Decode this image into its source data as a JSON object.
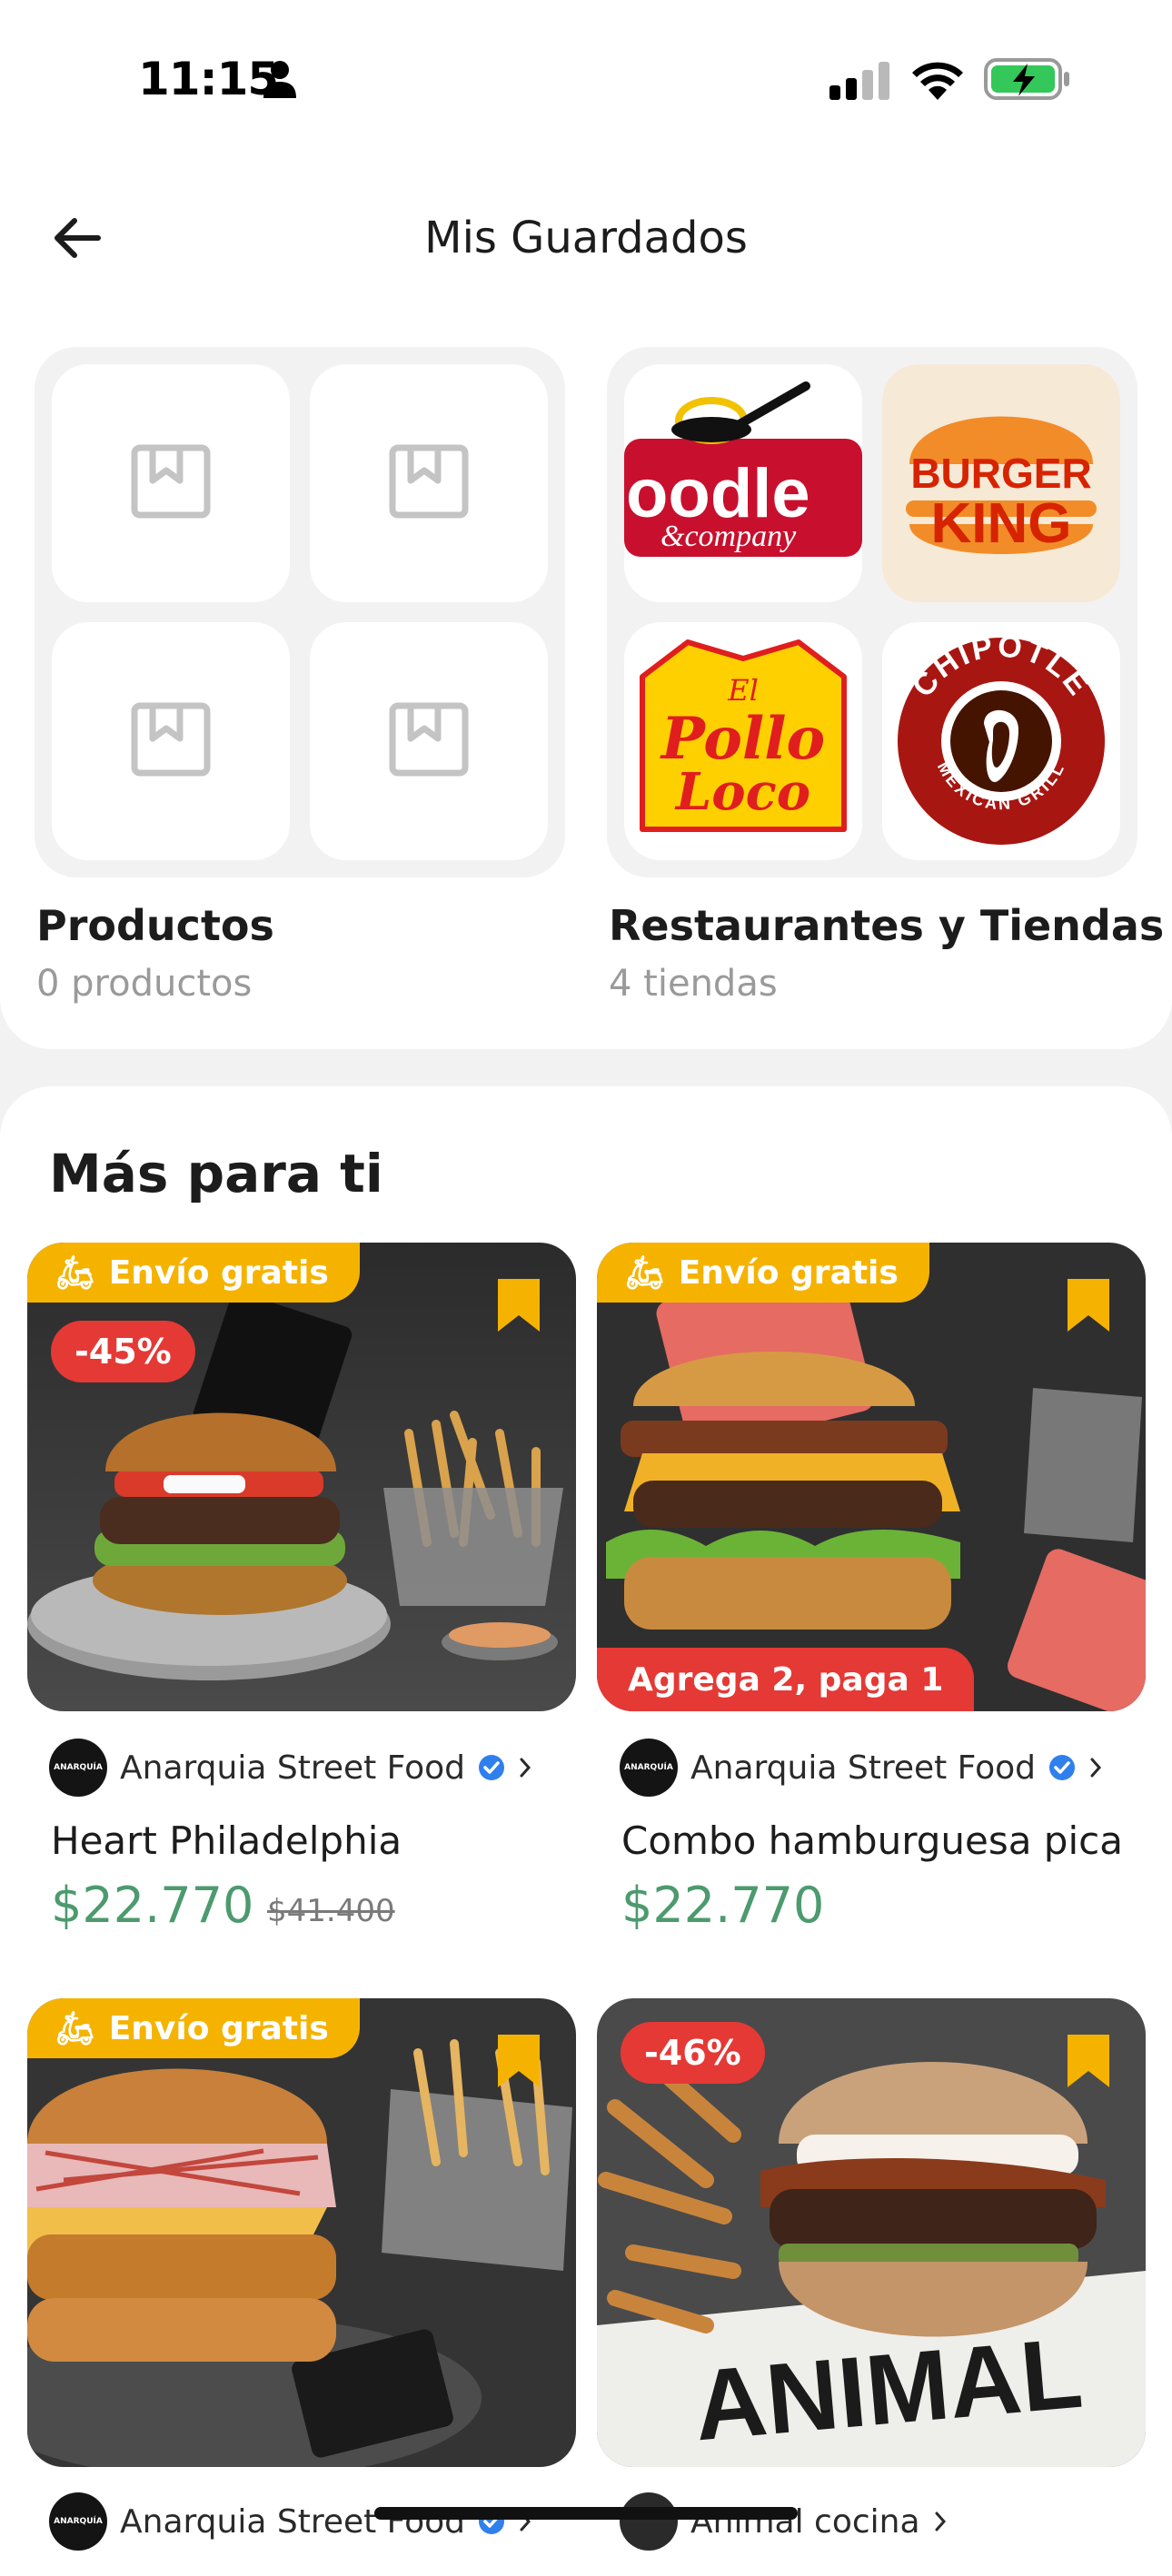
{
  "status_bar": {
    "time": "11:15"
  },
  "header": {
    "title": "Mis Guardados"
  },
  "groups": [
    {
      "title": "Productos",
      "subtitle": "0 productos"
    },
    {
      "title": "Restaurantes y Tiendas",
      "subtitle": "4 tiendas",
      "logos": [
        {
          "name": "Noodles & Company",
          "line1": "oodle",
          "line2": "&company"
        },
        {
          "name": "Burger King",
          "line1": "BURGER",
          "line2": "KING"
        },
        {
          "name": "El Pollo Loco",
          "line1": "El",
          "line2": "Pollo",
          "line3": "Loco"
        },
        {
          "name": "Chipotle",
          "line1": "CHIPOTLE",
          "line2": "MEXICAN GRILL"
        }
      ]
    }
  ],
  "section": {
    "title": "Más para ti"
  },
  "cards": [
    {
      "ribbon": "Envío gratis",
      "discount": "-45%",
      "promo": "",
      "store": "Anarquia Street Food",
      "store_logo": "ANARQUÍA",
      "name": "Heart Philadelphia",
      "price": "$22.770",
      "old_price": "$41.400",
      "colors": {
        "bg": "#3a3a3a",
        "bun": "#c98a3c"
      }
    },
    {
      "ribbon": "Envío gratis",
      "discount": "",
      "promo": "Agrega 2, paga 1",
      "store": "Anarquia Street Food",
      "store_logo": "ANARQUÍA",
      "name": "Combo hamburguesa pica",
      "price": "$22.770",
      "old_price": "",
      "colors": {
        "bg": "#2f2f2f",
        "bun": "#d2953f"
      }
    },
    {
      "ribbon": "Envío gratis",
      "discount": "",
      "promo": "",
      "store": "Anarquia Street Food",
      "store_logo": "ANARQUÍA",
      "name": "",
      "price": "",
      "old_price": "",
      "colors": {
        "bg": "#343434",
        "bun": "#c8803a"
      }
    },
    {
      "ribbon": "",
      "discount": "-46%",
      "promo": "",
      "store": "Animal cocina",
      "store_logo": "",
      "name": "",
      "price": "",
      "old_price": "",
      "colors": {
        "bg": "#4a4a4a",
        "bun": "#caa27a"
      }
    }
  ],
  "colors": {
    "accent_yellow": "#f5b300",
    "discount_red": "#e53935",
    "price_green": "#4c9a6e",
    "verified_blue": "#2f80ed"
  }
}
